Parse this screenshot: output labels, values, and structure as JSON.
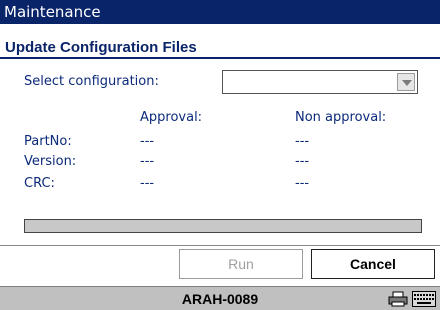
{
  "window": {
    "title": "Maintenance"
  },
  "page": {
    "subtitle": "Update Configuration Files"
  },
  "config": {
    "label": "Select configuration:",
    "selected_value": ""
  },
  "columns": {
    "approval": "Approval:",
    "non_approval": "Non approval:"
  },
  "rows": [
    {
      "label": "PartNo:",
      "approval": "---",
      "non_approval": "---"
    },
    {
      "label": "Version:",
      "approval": "---",
      "non_approval": "---"
    },
    {
      "label": "CRC:",
      "approval": "---",
      "non_approval": "---"
    }
  ],
  "progress": {
    "value": 0
  },
  "buttons": {
    "run": "Run",
    "cancel": "Cancel"
  },
  "status": {
    "device": "ARAH-0089",
    "icons": [
      "printer-icon",
      "keyboard-icon"
    ]
  },
  "colors": {
    "title_bar": "#0a246a",
    "label_text": "#0b2a7a",
    "status_bar": "#c0c0c0"
  }
}
